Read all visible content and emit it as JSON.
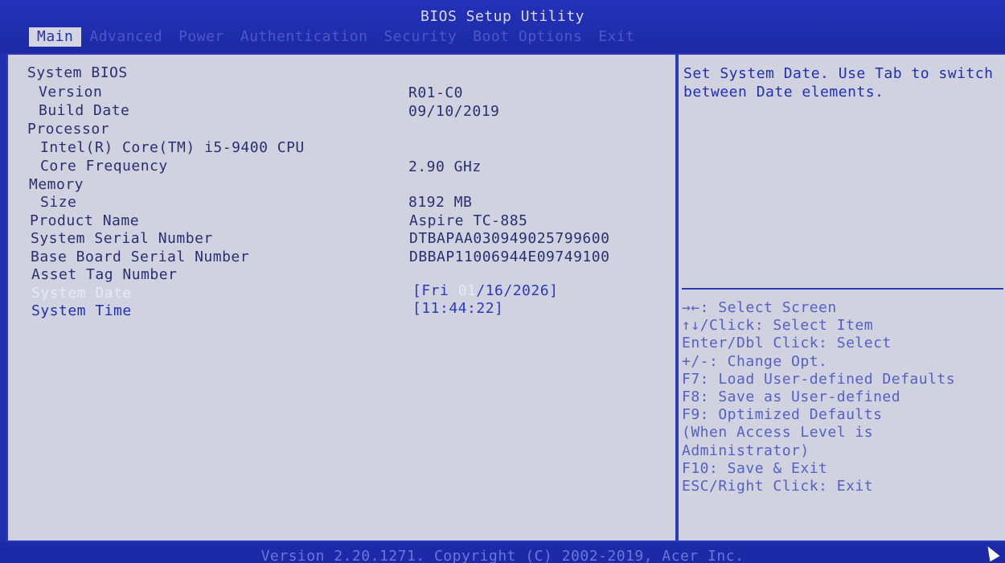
{
  "window": {
    "title": "BIOS Setup Utility"
  },
  "tabs": [
    {
      "label": "Main",
      "active": true
    },
    {
      "label": "Advanced",
      "active": false
    },
    {
      "label": "Power",
      "active": false
    },
    {
      "label": "Authentication",
      "active": false
    },
    {
      "label": "Security",
      "active": false
    },
    {
      "label": "Boot Options",
      "active": false
    },
    {
      "label": "Exit",
      "active": false
    }
  ],
  "main": {
    "system_bios_label": "System BIOS",
    "version_label": "Version",
    "version_value": "R01-C0",
    "build_date_label": "Build Date",
    "build_date_value": "09/10/2019",
    "processor_label": "Processor",
    "cpu_name": "Intel(R) Core(TM) i5-9400 CPU",
    "core_freq_label": "Core Frequency",
    "core_freq_value": "2.90 GHz",
    "memory_label": "Memory",
    "size_label": "Size",
    "size_value": "8192 MB",
    "product_name_label": "Product Name",
    "product_name_value": "Aspire TC-885",
    "serial_label": "System Serial Number",
    "serial_value": "DTBAPAA030949025799600",
    "board_serial_label": "Base Board Serial Number",
    "board_serial_value": "DBBAP11006944E09749100",
    "asset_tag_label": "Asset Tag Number",
    "system_date_label": "System Date",
    "system_date_value_pre": "[Fri ",
    "system_date_value_sel": "01",
    "system_date_value_post": "/16/2026]",
    "system_time_label": "System Time",
    "system_time_value": "[11:44:22]"
  },
  "help": {
    "description": "Set System Date. Use Tab to switch between Date elements.",
    "keys": [
      "→←: Select Screen",
      "↑↓/Click: Select Item",
      "Enter/Dbl Click: Select",
      "+/-: Change Opt.",
      "F7: Load User-defined Defaults",
      "F8: Save as User-defined",
      "F9: Optimized Defaults",
      "(When Access Level is",
      "Administrator)",
      "F10: Save & Exit",
      "ESC/Right Click: Exit"
    ]
  },
  "footer": {
    "text": "Version 2.20.1271. Copyright (C) 2002-2019, Acer Inc."
  },
  "colors": {
    "background_blue": "#1f2fb0",
    "panel_gray": "#d0d2e0",
    "selected_text": "#e8e9f4"
  }
}
